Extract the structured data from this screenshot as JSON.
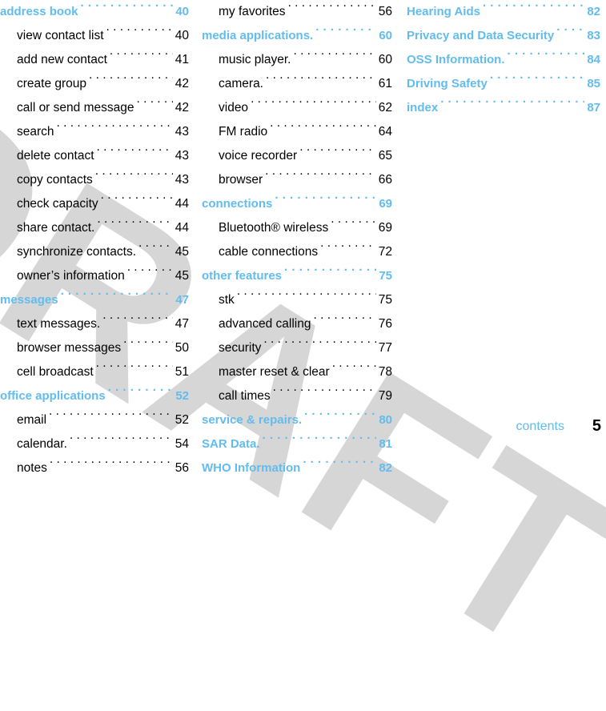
{
  "document": {
    "kind": "table-of-contents",
    "footer_label": "contents",
    "page_number": "5",
    "watermark_text": "DRAFT"
  },
  "colors": {
    "heading_blue": "#62bced",
    "body_black": "#000000",
    "watermark_gray": "#d6d6d6",
    "background": "#ffffff"
  },
  "columns": [
    {
      "id": "column-1",
      "rows": [
        {
          "type": "heading",
          "label": "address book",
          "page": "40"
        },
        {
          "type": "item",
          "label": "view contact list",
          "page": "40"
        },
        {
          "type": "item",
          "label": "add new contact",
          "page": "41"
        },
        {
          "type": "item",
          "label": "create group",
          "page": "42"
        },
        {
          "type": "item",
          "label": "call or send message",
          "page": "42"
        },
        {
          "type": "item",
          "label": "search",
          "page": "43"
        },
        {
          "type": "item",
          "label": "delete contact",
          "page": "43"
        },
        {
          "type": "item",
          "label": "copy contacts",
          "page": "43"
        },
        {
          "type": "item",
          "label": "check capacity",
          "page": "44"
        },
        {
          "type": "item",
          "label": "share contact.",
          "page": "44"
        },
        {
          "type": "item",
          "label": "synchronize contacts.",
          "page": "45"
        },
        {
          "type": "item",
          "label": "owner’s information",
          "page": "45"
        },
        {
          "type": "heading",
          "label": "messages",
          "page": "47"
        },
        {
          "type": "item",
          "label": "text messages.",
          "page": "47"
        },
        {
          "type": "item",
          "label": "browser messages",
          "page": "50"
        },
        {
          "type": "item",
          "label": "cell broadcast",
          "page": "51"
        },
        {
          "type": "heading",
          "label": "office applications",
          "page": "52"
        },
        {
          "type": "item",
          "label": "email",
          "page": "52"
        },
        {
          "type": "item",
          "label": "calendar.",
          "page": "54"
        },
        {
          "type": "item",
          "label": "notes",
          "page": "56"
        }
      ]
    },
    {
      "id": "column-2",
      "rows": [
        {
          "type": "item",
          "label": "my favorites",
          "page": "56"
        },
        {
          "type": "heading",
          "label": "media applications.",
          "page": "60"
        },
        {
          "type": "item",
          "label": "music player.",
          "page": "60"
        },
        {
          "type": "item",
          "label": "camera.",
          "page": "61"
        },
        {
          "type": "item",
          "label": "video",
          "page": "62"
        },
        {
          "type": "item",
          "label": "FM radio",
          "page": "64"
        },
        {
          "type": "item",
          "label": "voice recorder",
          "page": "65"
        },
        {
          "type": "item",
          "label": "browser",
          "page": "66"
        },
        {
          "type": "heading",
          "label": "connections",
          "page": "69"
        },
        {
          "type": "item",
          "label": "Bluetooth® wireless",
          "page": "69"
        },
        {
          "type": "item",
          "label": "cable connections",
          "page": "72"
        },
        {
          "type": "heading",
          "label": "other features",
          "page": "75"
        },
        {
          "type": "item",
          "label": "stk",
          "page": "75"
        },
        {
          "type": "item",
          "label": "advanced calling",
          "page": "76"
        },
        {
          "type": "item",
          "label": "security",
          "page": "77"
        },
        {
          "type": "item",
          "label": "master reset & clear",
          "page": "78"
        },
        {
          "type": "item",
          "label": "call times",
          "page": "79"
        },
        {
          "type": "heading",
          "label": "service & repairs.",
          "page": "80"
        },
        {
          "type": "heading",
          "label": "SAR Data.",
          "page": "81"
        },
        {
          "type": "heading",
          "label": "WHO Information",
          "page": "82"
        }
      ]
    },
    {
      "id": "column-3",
      "rows": [
        {
          "type": "heading",
          "label": "Hearing Aids",
          "page": "82"
        },
        {
          "type": "heading",
          "label": "Privacy and Data Security",
          "page": "83"
        },
        {
          "type": "heading",
          "label": "OSS Information.",
          "page": "84"
        },
        {
          "type": "heading",
          "label": "Driving Safety",
          "page": "85"
        },
        {
          "type": "heading",
          "label": "index",
          "page": "87"
        }
      ]
    }
  ]
}
